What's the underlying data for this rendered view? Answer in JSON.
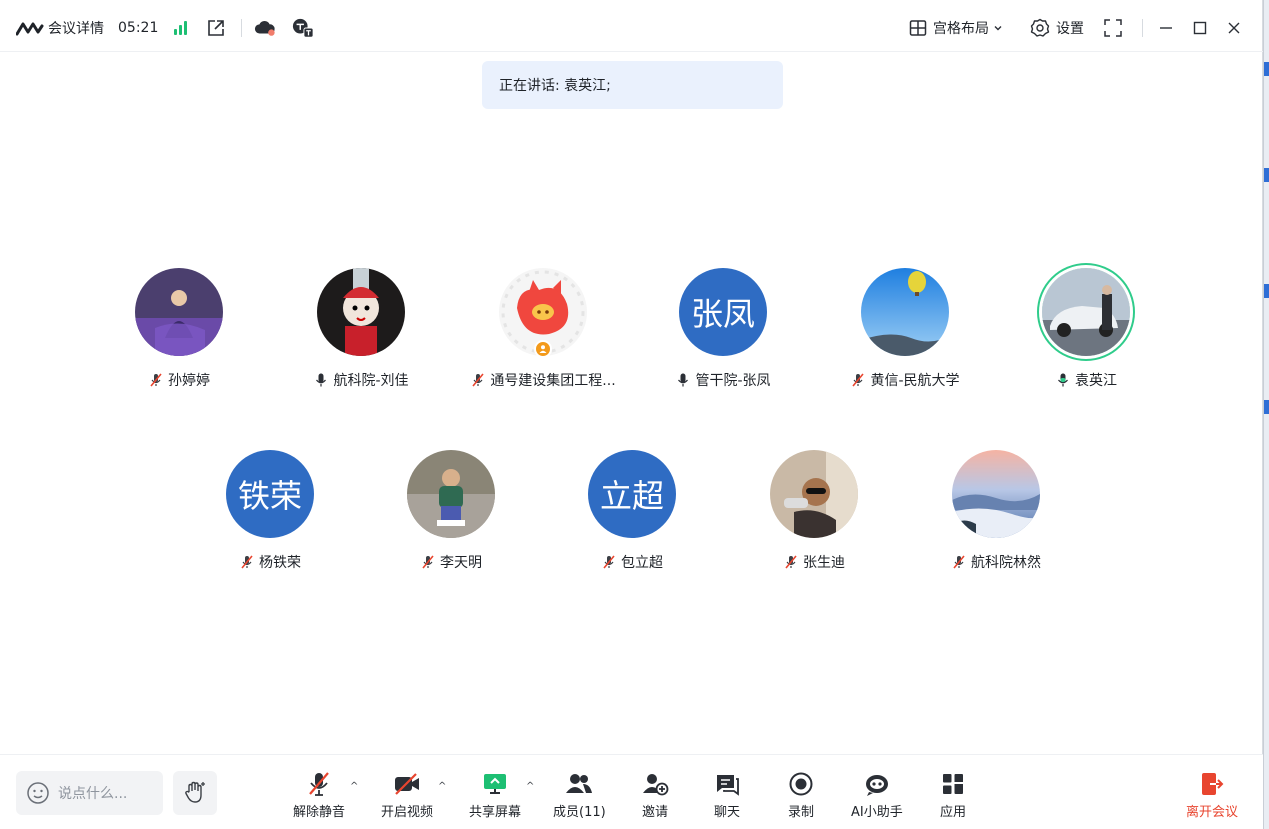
{
  "titlebar": {
    "meeting_info": "会议详情",
    "timer": "05:21",
    "layout_label": "宫格布局",
    "settings_label": "设置"
  },
  "speaking": {
    "text": "正在讲话: 袁英江;"
  },
  "participants": [
    {
      "name": "孙婷婷",
      "mic": "muted"
    },
    {
      "name": "航科院-刘佳",
      "mic": "on"
    },
    {
      "name": "通号建设集团工程...",
      "mic": "muted"
    },
    {
      "name": "管干院-张凤",
      "mic": "on",
      "avatar_text": "张凤"
    },
    {
      "name": "黄信-民航大学",
      "mic": "muted"
    },
    {
      "name": "袁英江",
      "mic": "speaking"
    },
    {
      "name": "杨铁荣",
      "mic": "muted",
      "avatar_text": "铁荣"
    },
    {
      "name": "李天明",
      "mic": "muted"
    },
    {
      "name": "包立超",
      "mic": "muted",
      "avatar_text": "立超"
    },
    {
      "name": "张生迪",
      "mic": "muted"
    },
    {
      "name": "航科院林然",
      "mic": "muted"
    }
  ],
  "bottombar": {
    "chat_placeholder": "说点什么...",
    "unmute": "解除静音",
    "start_video": "开启视频",
    "share_screen": "共享屏幕",
    "members": "成员(11)",
    "invite": "邀请",
    "chat": "聊天",
    "record": "录制",
    "ai_assistant": "AI小助手",
    "apps": "应用",
    "leave": "离开会议"
  },
  "colors": {
    "accent_blue": "#2f6cc3",
    "speaking_green": "#2fcc8b",
    "signal_green": "#1dbf73",
    "leave_red": "#e8452f",
    "muted_red": "#e8452f",
    "toast_bg": "#eaf1fd"
  }
}
